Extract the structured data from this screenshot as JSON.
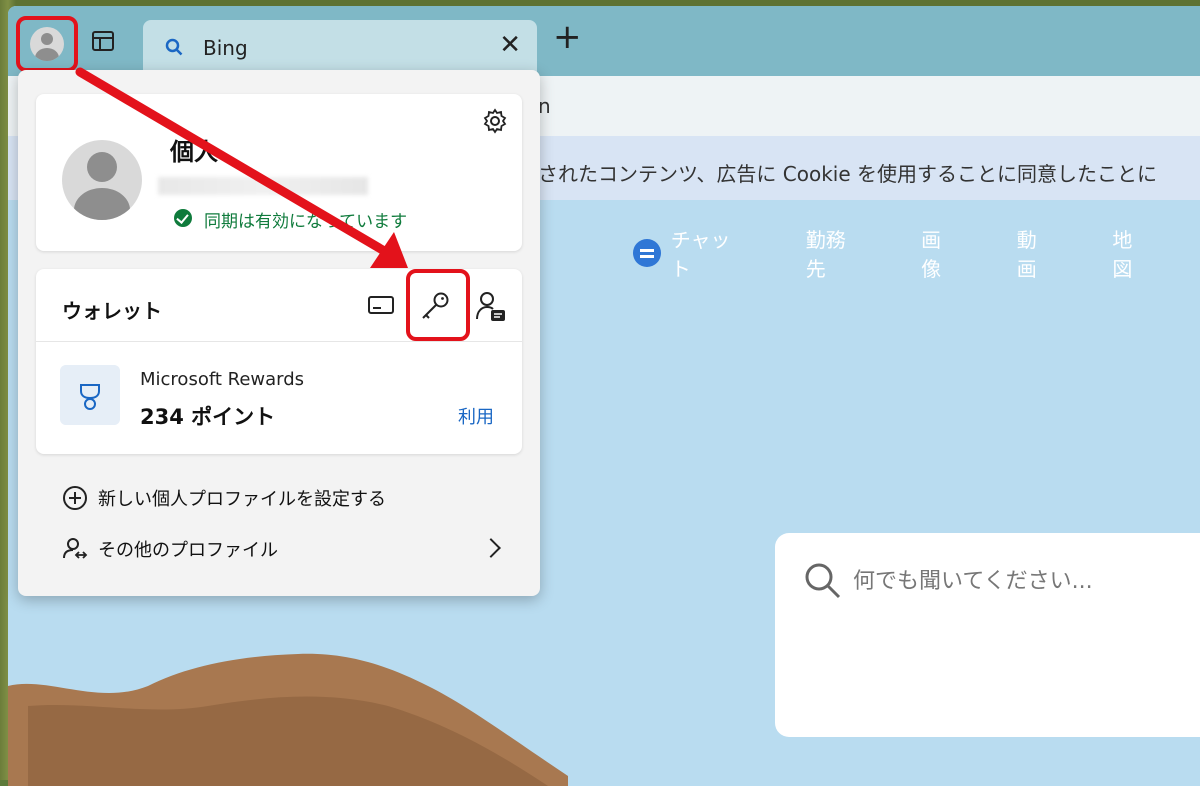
{
  "tabstrip": {
    "tab_title": "Bing",
    "close_glyph": "✕",
    "new_tab_glyph": "+"
  },
  "address_bar": {
    "visible_text": "n"
  },
  "cookie_banner": {
    "text": "されたコンテンツ、広告に Cookie を使用することに同意したことに"
  },
  "bing_nav": {
    "items": [
      "チャット",
      "勤務先",
      "画像",
      "動画",
      "地図"
    ]
  },
  "search": {
    "placeholder": "何でも聞いてください..."
  },
  "profile_panel": {
    "name": "個人",
    "sync_status": "同期は有効になっています",
    "wallet": {
      "title": "ウォレット",
      "rewards_label": "Microsoft Rewards",
      "rewards_points": "234 ポイント",
      "rewards_action": "利用"
    },
    "menu": {
      "new_profile": "新しい個人プロファイルを設定する",
      "other_profiles": "その他のプロファイル"
    }
  },
  "colors": {
    "highlight": "#e3121b",
    "sync_green": "#0f7b3c",
    "link_blue": "#1a67c4"
  }
}
